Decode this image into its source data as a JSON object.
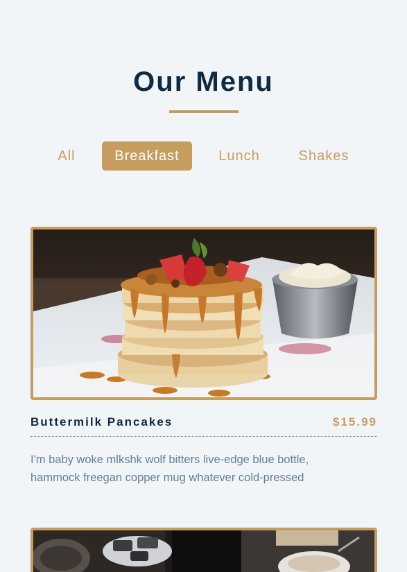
{
  "header": {
    "title": "Our Menu"
  },
  "tabs": [
    {
      "label": "All",
      "active": false
    },
    {
      "label": "Breakfast",
      "active": true
    },
    {
      "label": "Lunch",
      "active": false
    },
    {
      "label": "Shakes",
      "active": false
    }
  ],
  "items": [
    {
      "name": "Buttermilk Pancakes",
      "price": "$15.99",
      "description": "I'm baby woke mlkshk wolf bitters live-edge blue bottle, hammock freegan copper mug whatever cold-pressed"
    }
  ],
  "colors": {
    "accent": "#c59d5f",
    "heading": "#102a42",
    "body_text": "#617d98",
    "background": "#f1f5f8"
  }
}
